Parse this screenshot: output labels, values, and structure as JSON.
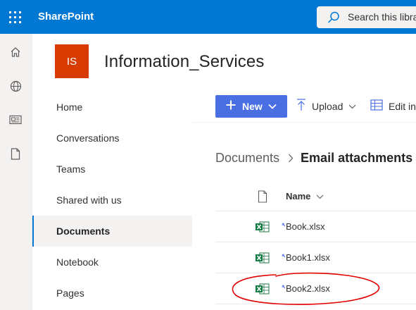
{
  "suite": {
    "app_name": "SharePoint",
    "search_placeholder": "Search this libra",
    "brand_color": "#0078d4"
  },
  "appbar": {
    "items": [
      "home-icon",
      "globe-icon",
      "news-icon",
      "file-icon"
    ]
  },
  "site": {
    "logo_initials": "IS",
    "logo_color": "#d83b01",
    "title": "Information_Services"
  },
  "nav": {
    "items": [
      {
        "label": "Home"
      },
      {
        "label": "Conversations"
      },
      {
        "label": "Teams"
      },
      {
        "label": "Shared with us"
      },
      {
        "label": "Documents",
        "selected": true
      },
      {
        "label": "Notebook"
      },
      {
        "label": "Pages"
      }
    ]
  },
  "commands": {
    "new_label": "New",
    "upload_label": "Upload",
    "edit_label": "Edit in"
  },
  "breadcrumb": {
    "root": "Documents",
    "current": "Email attachments"
  },
  "list": {
    "name_header": "Name",
    "files": [
      {
        "name": "Book.xlsx",
        "type": "excel-icon",
        "is_new": true
      },
      {
        "name": "Book1.xlsx",
        "type": "excel-icon",
        "is_new": true
      },
      {
        "name": "Book2.xlsx",
        "type": "excel-icon",
        "is_new": true,
        "circled": true
      }
    ]
  },
  "annotation_color": "#e00000"
}
